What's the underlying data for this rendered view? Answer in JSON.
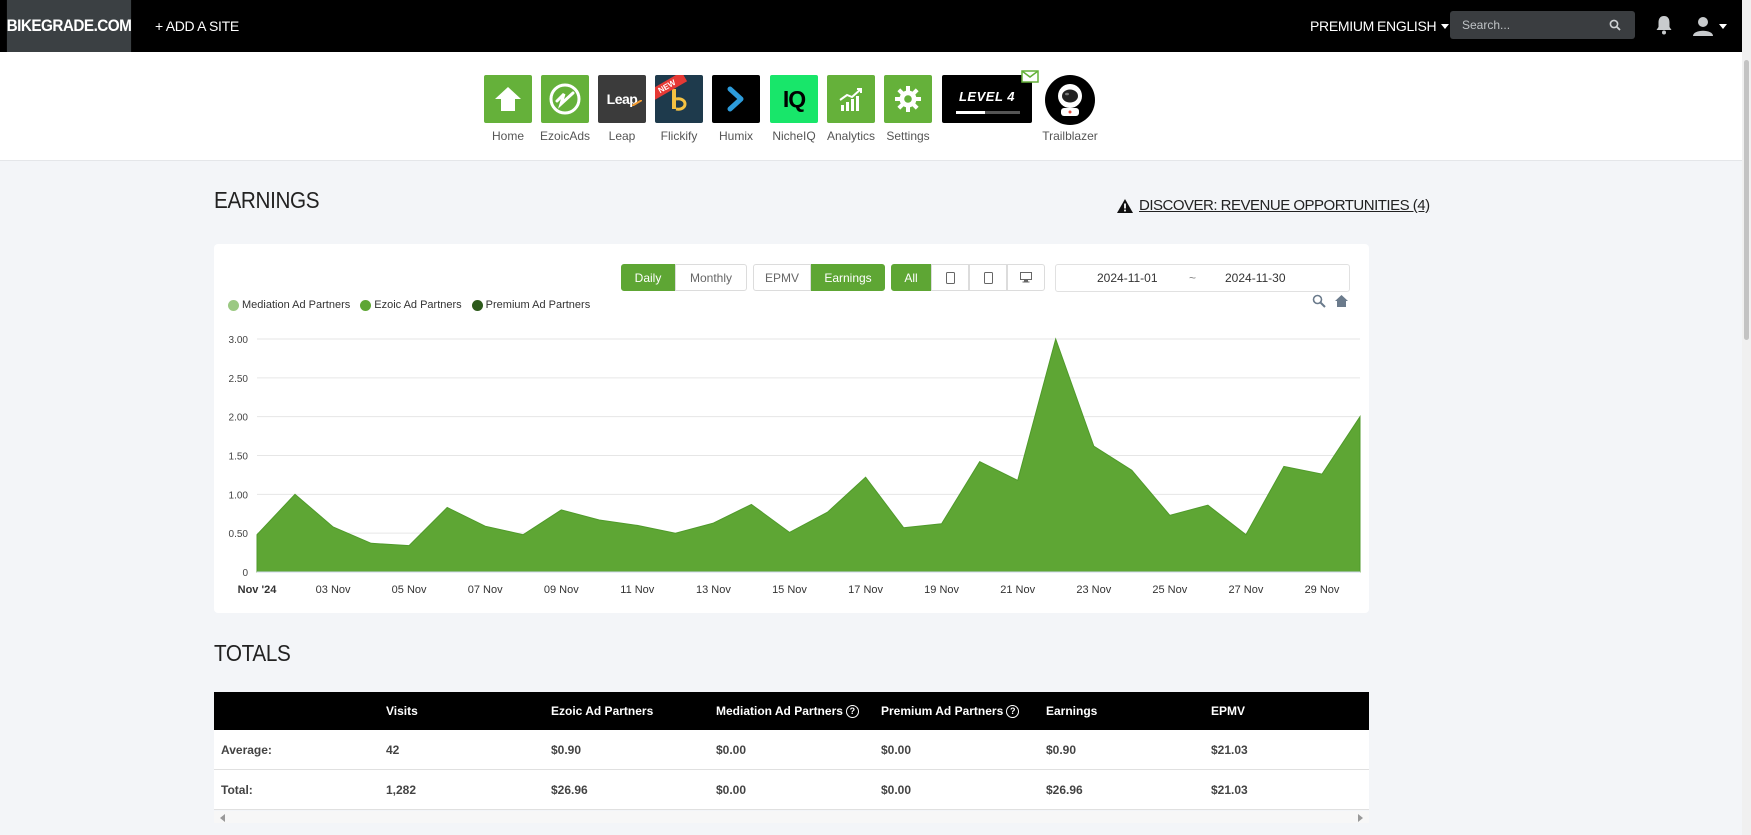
{
  "topbar": {
    "brand": "BIKEGRADE.COM",
    "add_site": "+ ADD A SITE",
    "premium": "PREMIUM",
    "language": "ENGLISH",
    "search_placeholder": "Search..."
  },
  "apps": [
    {
      "label": "Home",
      "icon": "home-icon"
    },
    {
      "label": "EzoicAds",
      "icon": "ezoic-ads-icon"
    },
    {
      "label": "Leap",
      "icon": "leap-logo",
      "tile_text": "Leap"
    },
    {
      "label": "Flickify",
      "icon": "flickify-icon",
      "badge": "NEW"
    },
    {
      "label": "Humix",
      "icon": "humix-icon"
    },
    {
      "label": "NicheIQ",
      "icon": "nicheiq-icon",
      "tile_text": "IQ"
    },
    {
      "label": "Analytics",
      "icon": "analytics-icon"
    },
    {
      "label": "Settings",
      "icon": "gear-icon"
    }
  ],
  "level": {
    "text": "LEVEL 4",
    "progress": 0.45
  },
  "trailblazer": {
    "label": "Trailblazer",
    "icon": "astronaut-icon"
  },
  "earnings": {
    "title": "EARNINGS",
    "discover": "DISCOVER: REVENUE OPPORTUNITIES (4)"
  },
  "controls": {
    "period": [
      "Daily",
      "Monthly"
    ],
    "period_active": "Daily",
    "metric": [
      "EPMV",
      "Earnings"
    ],
    "metric_active": "Earnings",
    "device_all": "All",
    "devices": [
      "tablet-icon",
      "phone-icon",
      "desktop-icon"
    ],
    "date_start": "2024-11-01",
    "date_sep": "~",
    "date_end": "2024-11-30"
  },
  "chart_data": {
    "type": "area",
    "legend": [
      {
        "name": "Mediation Ad Partners",
        "color": "#9bc983"
      },
      {
        "name": "Ezoic Ad Partners",
        "color": "#5ea634"
      },
      {
        "name": "Premium Ad Partners",
        "color": "#2d5a1b"
      }
    ],
    "x": [
      "2024-11-01",
      "2024-11-02",
      "2024-11-03",
      "2024-11-04",
      "2024-11-05",
      "2024-11-06",
      "2024-11-07",
      "2024-11-08",
      "2024-11-09",
      "2024-11-10",
      "2024-11-11",
      "2024-11-12",
      "2024-11-13",
      "2024-11-14",
      "2024-11-15",
      "2024-11-16",
      "2024-11-17",
      "2024-11-18",
      "2024-11-19",
      "2024-11-20",
      "2024-11-21",
      "2024-11-22",
      "2024-11-23",
      "2024-11-24",
      "2024-11-25",
      "2024-11-26",
      "2024-11-27",
      "2024-11-28",
      "2024-11-29",
      "2024-11-30"
    ],
    "series": [
      {
        "name": "Ezoic Ad Partners",
        "color": "#5ea634",
        "values": [
          0.48,
          1.0,
          0.58,
          0.37,
          0.34,
          0.83,
          0.59,
          0.48,
          0.8,
          0.67,
          0.6,
          0.5,
          0.63,
          0.87,
          0.51,
          0.77,
          1.22,
          0.57,
          0.62,
          1.42,
          1.18,
          3.0,
          1.62,
          1.31,
          0.73,
          0.86,
          0.48,
          1.36,
          1.26,
          2.0
        ]
      }
    ],
    "x_tick_labels": [
      "Nov '24",
      "03 Nov",
      "05 Nov",
      "07 Nov",
      "09 Nov",
      "11 Nov",
      "13 Nov",
      "15 Nov",
      "17 Nov",
      "19 Nov",
      "21 Nov",
      "23 Nov",
      "25 Nov",
      "27 Nov",
      "29 Nov"
    ],
    "y_tick_labels": [
      "0",
      "0.50",
      "1.00",
      "1.50",
      "2.00",
      "2.50",
      "3.00"
    ],
    "ylim": [
      0,
      3.0
    ],
    "grid": true
  },
  "totals": {
    "title": "TOTALS",
    "columns": [
      "",
      "Visits",
      "Ezoic Ad Partners",
      "Mediation Ad Partners",
      "Premium Ad Partners",
      "Earnings",
      "EPMV"
    ],
    "help_on": [
      3,
      4
    ],
    "rows": [
      [
        "Average:",
        "42",
        "$0.90",
        "$0.00",
        "$0.00",
        "$0.90",
        "$21.03"
      ],
      [
        "Total:",
        "1,282",
        "$26.96",
        "$0.00",
        "$0.00",
        "$26.96",
        "$21.03"
      ]
    ]
  }
}
